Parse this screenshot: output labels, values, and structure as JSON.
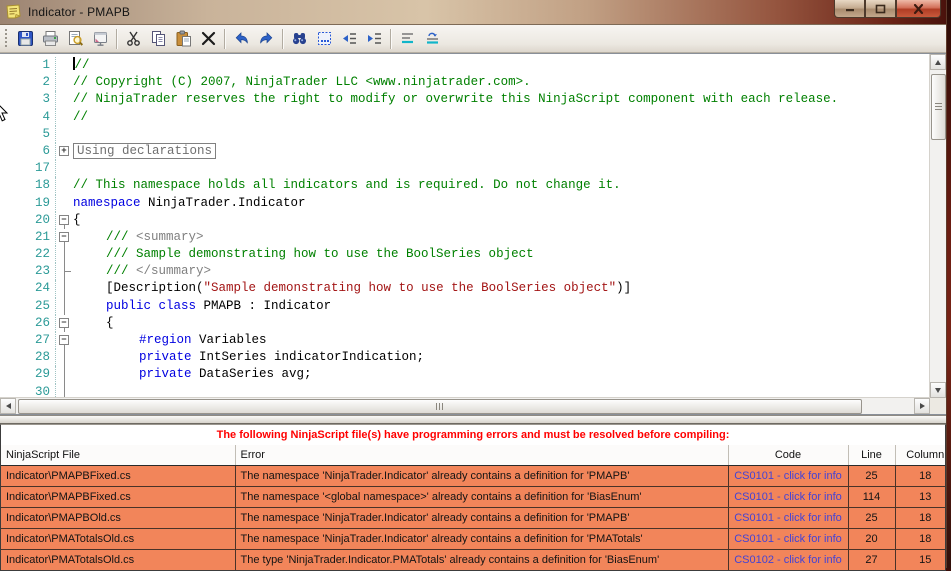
{
  "window": {
    "title": "Indicator - PMAPB",
    "controls": [
      "minimize",
      "maximize",
      "close"
    ]
  },
  "toolbar": {
    "icons": [
      "save-icon",
      "print-icon",
      "print-preview-icon",
      "page-setup-icon",
      "cut-icon",
      "copy-icon",
      "paste-icon",
      "delete-icon",
      "undo-icon",
      "redo-icon",
      "find-icon",
      "select-all-icon",
      "outdent-icon",
      "indent-icon",
      "comment-icon",
      "uncomment-icon"
    ]
  },
  "editor": {
    "lines": [
      {
        "n": "1",
        "indent": 0,
        "cursor": true,
        "tokens": [
          {
            "c": "com",
            "t": "//"
          }
        ]
      },
      {
        "n": "2",
        "indent": 0,
        "tokens": [
          {
            "c": "com",
            "t": "// Copyright (C) 2007, NinjaTrader LLC <www.ninjatrader.com>."
          }
        ]
      },
      {
        "n": "3",
        "indent": 0,
        "tokens": [
          {
            "c": "com",
            "t": "// NinjaTrader reserves the right to modify or overwrite this NinjaScript component with each release."
          }
        ]
      },
      {
        "n": "4",
        "indent": 0,
        "tokens": [
          {
            "c": "com",
            "t": "//"
          }
        ]
      },
      {
        "n": "5",
        "indent": 0,
        "tokens": []
      },
      {
        "n": "6",
        "indent": 0,
        "fold": "plus",
        "collapsed": "Using declarations",
        "tokens": []
      },
      {
        "n": "17",
        "indent": 0,
        "tokens": []
      },
      {
        "n": "18",
        "indent": 0,
        "tokens": [
          {
            "c": "com",
            "t": "// This namespace holds all indicators and is required. Do not change it."
          }
        ]
      },
      {
        "n": "19",
        "indent": 0,
        "tokens": [
          {
            "c": "kw",
            "t": "namespace"
          },
          {
            "c": "pln",
            "t": " NinjaTrader.Indicator"
          }
        ]
      },
      {
        "n": "20",
        "indent": 0,
        "fold": "minus",
        "tokens": [
          {
            "c": "pln",
            "t": "{"
          }
        ]
      },
      {
        "n": "21",
        "indent": 1,
        "fold": "minus",
        "tokens": [
          {
            "c": "com",
            "t": "/// "
          },
          {
            "c": "doc",
            "t": "<summary>"
          }
        ]
      },
      {
        "n": "22",
        "indent": 1,
        "fold": "line",
        "tokens": [
          {
            "c": "com",
            "t": "/// Sample demonstrating how to use the BoolSeries object"
          }
        ]
      },
      {
        "n": "23",
        "indent": 1,
        "fold": "end",
        "tokens": [
          {
            "c": "com",
            "t": "/// "
          },
          {
            "c": "doc",
            "t": "</summary>"
          }
        ]
      },
      {
        "n": "24",
        "indent": 1,
        "fold": "line",
        "tokens": [
          {
            "c": "pln",
            "t": "[Description("
          },
          {
            "c": "str",
            "t": "\"Sample demonstrating how to use the BoolSeries object\""
          },
          {
            "c": "pln",
            "t": ")]"
          }
        ]
      },
      {
        "n": "25",
        "indent": 1,
        "fold": "line",
        "tokens": [
          {
            "c": "kw",
            "t": "public"
          },
          {
            "c": "pln",
            "t": " "
          },
          {
            "c": "kw",
            "t": "class"
          },
          {
            "c": "pln",
            "t": " PMAPB : Indicator"
          }
        ]
      },
      {
        "n": "26",
        "indent": 1,
        "fold": "minus",
        "tokens": [
          {
            "c": "pln",
            "t": "{"
          }
        ]
      },
      {
        "n": "27",
        "indent": 2,
        "fold": "minus",
        "tokens": [
          {
            "c": "kw",
            "t": "#region"
          },
          {
            "c": "pln",
            "t": " Variables"
          }
        ]
      },
      {
        "n": "28",
        "indent": 2,
        "fold": "line",
        "tokens": [
          {
            "c": "kw",
            "t": "private"
          },
          {
            "c": "pln",
            "t": " IntSeries indicatorIndication;"
          }
        ]
      },
      {
        "n": "29",
        "indent": 2,
        "fold": "line",
        "tokens": [
          {
            "c": "kw",
            "t": "private"
          },
          {
            "c": "pln",
            "t": " DataSeries avg;"
          }
        ]
      },
      {
        "n": "30",
        "indent": 0,
        "fold": "line",
        "tokens": []
      }
    ]
  },
  "errors": {
    "message": "The following NinjaScript file(s) have programming errors and must be resolved before compiling:",
    "columns": [
      "NinjaScript File",
      "Error",
      "Code",
      "Line",
      "Column"
    ],
    "rows": [
      {
        "file": "Indicator\\PMAPBFixed.cs",
        "error": "The namespace 'NinjaTrader.Indicator' already contains a definition for 'PMAPB'",
        "code": "CS0101 - click for info",
        "line": "25",
        "column": "18"
      },
      {
        "file": "Indicator\\PMAPBFixed.cs",
        "error": "The namespace '<global namespace>' already contains a definition for 'BiasEnum'",
        "code": "CS0101 - click for info",
        "line": "114",
        "column": "13"
      },
      {
        "file": "Indicator\\PMAPBOld.cs",
        "error": "The namespace 'NinjaTrader.Indicator' already contains a definition for 'PMAPB'",
        "code": "CS0101 - click for info",
        "line": "25",
        "column": "18"
      },
      {
        "file": "Indicator\\PMATotalsOld.cs",
        "error": "The namespace 'NinjaTrader.Indicator' already contains a definition for 'PMATotals'",
        "code": "CS0101 - click for info",
        "line": "20",
        "column": "18"
      },
      {
        "file": "Indicator\\PMATotalsOld.cs",
        "error": "The type 'NinjaTrader.Indicator.PMATotals' already contains a definition for 'BiasEnum'",
        "code": "CS0102 - click for info",
        "line": "27",
        "column": "15"
      }
    ]
  },
  "colors": {
    "error_row_bg": "#f2855a",
    "error_link": "#4343d6",
    "error_message": "#ff0000",
    "comment": "#008000",
    "keyword": "#0000e0",
    "string": "#a31515",
    "doc_tag": "#808080",
    "line_number": "#2b9a97",
    "close_button": "#b03d24"
  }
}
